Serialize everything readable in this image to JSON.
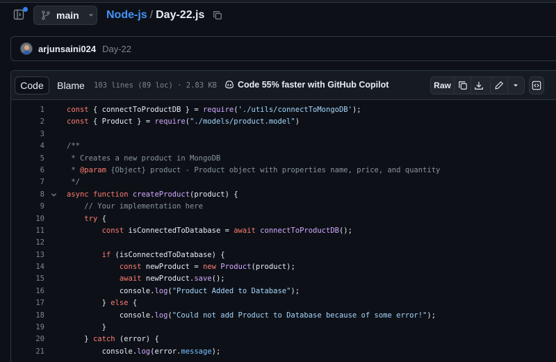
{
  "header": {
    "branch": "main",
    "repo": "Node-js",
    "separator": "/",
    "file": "Day-22.js"
  },
  "commit": {
    "author": "arjunsaini024",
    "message": "Day-22"
  },
  "file_header": {
    "tabs": [
      "Code",
      "Blame"
    ],
    "meta": "103 lines (89 loc) · 2.83 KB",
    "copilot": "Code 55% faster with GitHub Copilot",
    "raw_label": "Raw"
  },
  "colors": {
    "background": "#0d1117",
    "link": "#4493f8",
    "keyword": "#ff7b72",
    "function": "#d2a8ff",
    "string": "#a5d6ff",
    "comment": "#8b949e"
  },
  "code_lines": [
    {
      "n": "1",
      "fold": false,
      "html": "const { connectToProductDB } = require('./utils/connectToMongoDB');"
    },
    {
      "n": "2",
      "fold": false,
      "html": "const { Product } = require(\"./models/product.model\")"
    },
    {
      "n": "3",
      "fold": false,
      "html": ""
    },
    {
      "n": "4",
      "fold": false,
      "html": "/**"
    },
    {
      "n": "5",
      "fold": false,
      "html": " * Creates a new product in MongoDB"
    },
    {
      "n": "6",
      "fold": false,
      "html": " * @param {Object} product - Product object with properties name, price, and quantity"
    },
    {
      "n": "7",
      "fold": false,
      "html": " */"
    },
    {
      "n": "8",
      "fold": true,
      "html": "async function createProduct(product) {"
    },
    {
      "n": "9",
      "fold": false,
      "html": "    // Your implementation here"
    },
    {
      "n": "10",
      "fold": false,
      "html": "    try {"
    },
    {
      "n": "11",
      "fold": false,
      "html": "        const isConnectedToDatabase = await connectToProductDB();"
    },
    {
      "n": "12",
      "fold": false,
      "html": ""
    },
    {
      "n": "13",
      "fold": false,
      "html": "        if (isConnectedToDatabase) {"
    },
    {
      "n": "14",
      "fold": false,
      "html": "            const newProduct = new Product(product);"
    },
    {
      "n": "15",
      "fold": false,
      "html": "            await newProduct.save();"
    },
    {
      "n": "16",
      "fold": false,
      "html": "            console.log(\"Product Added to Database\");"
    },
    {
      "n": "17",
      "fold": false,
      "html": "        } else {"
    },
    {
      "n": "18",
      "fold": false,
      "html": "            console.log(\"Could not add Product to Database because of some error!\");"
    },
    {
      "n": "19",
      "fold": false,
      "html": "        }"
    },
    {
      "n": "20",
      "fold": false,
      "html": "    } catch (error) {"
    },
    {
      "n": "21",
      "fold": false,
      "html": "        console.log(error.message);"
    }
  ]
}
